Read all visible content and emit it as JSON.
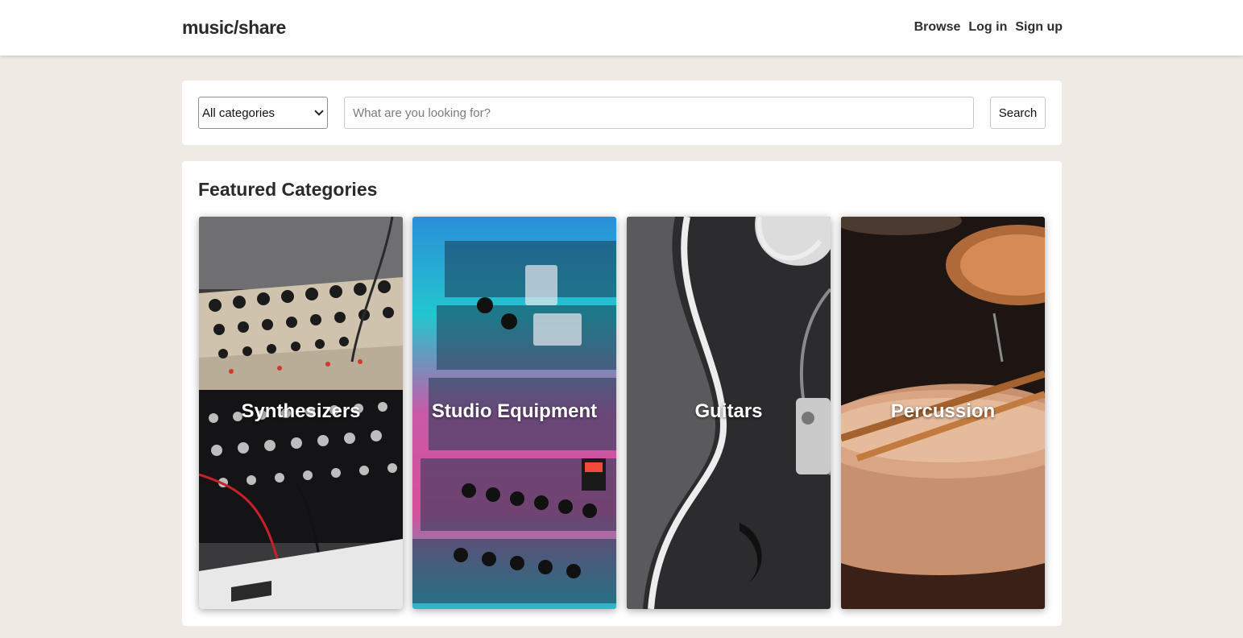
{
  "header": {
    "logo": "music/share",
    "nav": [
      {
        "label": "Browse"
      },
      {
        "label": "Log in"
      },
      {
        "label": "Sign up"
      }
    ]
  },
  "search": {
    "category_selected": "All categories",
    "placeholder": "What are you looking for?",
    "button_label": "Search"
  },
  "featured": {
    "title": "Featured Categories",
    "cards": [
      {
        "label": "Synthesizers",
        "image": "synthesizer-photo"
      },
      {
        "label": "Studio Equipment",
        "image": "studio-rack-photo"
      },
      {
        "label": "Guitars",
        "image": "guitar-photo"
      },
      {
        "label": "Percussion",
        "image": "drum-photo"
      }
    ]
  },
  "colors": {
    "page_bg": "#efebe4",
    "panel_bg": "#ffffff",
    "text": "#2b2b2b"
  }
}
